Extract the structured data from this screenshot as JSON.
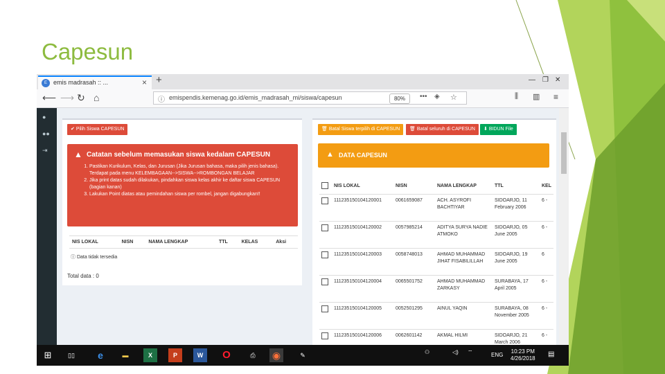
{
  "slide": {
    "title": "Capesun"
  },
  "colors": {
    "slide_green": "#8dbb3f",
    "sidebar": "#222d32",
    "danger": "#dd4b39",
    "warning": "#f39c12",
    "success": "#00a65a",
    "taskbar": "#101010"
  },
  "browser": {
    "tab_title": "emis madrasah :: ...",
    "tab_icon": "emis-favicon",
    "url": "emispendis.kemenag.go.id/emis_madrasah_mi/siswa/capesun",
    "zoom": "80%",
    "more": "•••",
    "window_controls": [
      "minimize-icon",
      "restore-icon",
      "close-icon"
    ]
  },
  "left_panel": {
    "pick_button": "Pilih Siswa CAPESUN",
    "alert_title": "Catatan sebelum memasukan siswa kedalam CAPESUN",
    "alert_items": [
      "Pastikan Kurikulum, Kelas, dan Jurusan (Jika Jurusan bahasa, maka pilih jenis bahasa). Terdapat pada menu KELEMBAGAAN-->SISWA-->ROMBONGAN BELAJAR",
      "Jika print datas sudah dilakukan, pindahkan siswa kelas akhir ke daftar siswa CAPESUN (bagian kanan)",
      "Lakukan Point diatas atau pemindahan siswa per rombel, jangan digabungkan!!"
    ],
    "table_headers": [
      "NIS LOKAL",
      "NISN",
      "NAMA LENGKAP",
      "TTL",
      "KELAS",
      "Aksi"
    ],
    "empty_text": "Data tidak tersedia",
    "total_text": "Total data : 0"
  },
  "right_panel": {
    "buttons": [
      {
        "label": "Batal Siswa terpilih di CAPESUN",
        "color": "#f39c12"
      },
      {
        "label": "Batal seluruh di CAPESUN",
        "color": "#dd4b39"
      },
      {
        "label": "BIDUN File",
        "color": "#00a65a"
      }
    ],
    "box_title": "DATA CAPESUN",
    "table_headers": [
      "NIS LOKAL",
      "NISN",
      "NAMA LENGKAP",
      "TTL",
      "KEL"
    ],
    "rows": [
      {
        "nis": "111235150104120001",
        "nisn": "0061659087",
        "nama": "ACH. ASYROFI BACHTIYAR",
        "ttl": "SIDOARJO, 11 February 2006",
        "kel": "6 -"
      },
      {
        "nis": "111235150104120002",
        "nisn": "0057985214",
        "nama": "ADITYA SURYA NADIE ATMOKO",
        "ttl": "SIDOARJO, 05 June 2005",
        "kel": "6 -"
      },
      {
        "nis": "111235150104120003",
        "nisn": "0058748013",
        "nama": "AHMAD MUHAMMAD JIHAT FISABILILLAH",
        "ttl": "SIDOARJO, 19 June 2005",
        "kel": "6"
      },
      {
        "nis": "111235150104120004",
        "nisn": "0065501752",
        "nama": "AHMAD MUHAMMAD ZARKASY",
        "ttl": "SURABAYA, 17 April 2005",
        "kel": "6 -"
      },
      {
        "nis": "111235150104120005",
        "nisn": "0052501295",
        "nama": "AINUL YAQIN",
        "ttl": "SURABAYA, 08 November 2005",
        "kel": "6 -"
      },
      {
        "nis": "111235150104120006",
        "nisn": "0062601142",
        "nama": "AKMAL HILMI",
        "ttl": "SIDOARJO, 21 March 2006",
        "kel": "6 -"
      }
    ]
  },
  "taskbar": {
    "lang": "ENG",
    "time": "10:23 PM",
    "date": "4/26/2018",
    "apps": [
      "start-icon",
      "task-view-icon",
      "edge-icon",
      "file-explorer-icon",
      "excel-icon",
      "powerpoint-icon",
      "word-icon",
      "opera-icon",
      "printer-icon",
      "firefox-icon",
      "paint-icon"
    ],
    "tray_icons": [
      "people-icon",
      "network-icon",
      "volume-icon",
      "notification-icon"
    ]
  }
}
